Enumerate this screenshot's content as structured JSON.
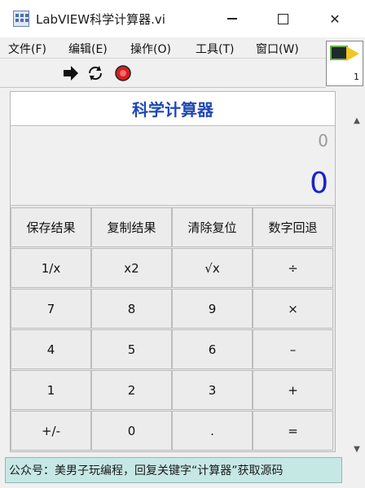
{
  "window": {
    "title": "LabVIEW科学计算器.vi",
    "minimize": "—",
    "close": "✕"
  },
  "menu": [
    "文件(F)",
    "编辑(E)",
    "操作(O)",
    "工具(T)",
    "窗口(W)"
  ],
  "toolbar": {
    "run_icon": "run-arrow-icon",
    "continuous_icon": "run-continuously-icon",
    "abort_icon": "abort-stop-icon"
  },
  "vi_icon": {
    "label": "1"
  },
  "calculator": {
    "title": "科学计算器",
    "expression": "0",
    "result": "0",
    "accent_color": "#1f48b6",
    "result_color": "#1a23c8"
  },
  "buttons": [
    [
      "保存结果",
      "复制结果",
      "清除复位",
      "数字回退"
    ],
    [
      "1/x",
      "x2",
      "√x",
      "÷"
    ],
    [
      "7",
      "8",
      "9",
      "×"
    ],
    [
      "4",
      "5",
      "6",
      "–"
    ],
    [
      "1",
      "2",
      "3",
      "+"
    ],
    [
      "+/-",
      "0",
      ".",
      "="
    ]
  ],
  "footer": {
    "text": "公众号：美男子玩编程，回复关键字“计算器”获取源码"
  }
}
